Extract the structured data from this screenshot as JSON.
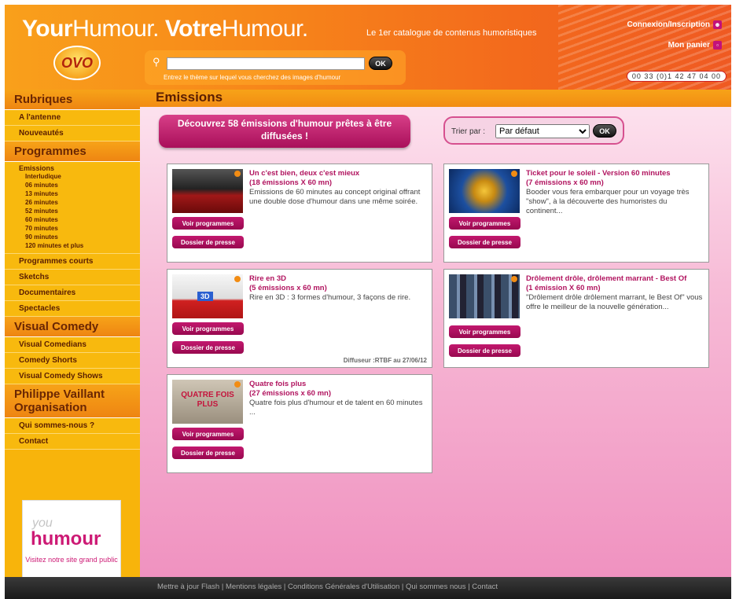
{
  "header": {
    "brand_your": "Your",
    "brand_humour1": "Humour.",
    "brand_votre": "Votre",
    "brand_humour2": "Humour.",
    "tagline": "Le 1er catalogue de contenus humoristiques",
    "logo_text": "OVO",
    "search_placeholder": "",
    "search_button": "OK",
    "search_hint": "Entrez le thème sur lequel vous cherchez des images d'humour",
    "link_login": "Connexion/Inscription",
    "link_cart": "Mon panier",
    "phone": "00 33 (0)1 42 47 04 00"
  },
  "sidebar": {
    "rubriques_title": "Rubriques",
    "rubriques": [
      "A l'antenne",
      "Nouveautés"
    ],
    "programmes_title": "Programmes",
    "emissions_label": "Emissions",
    "emissions_sub": [
      "Interludique",
      "06 minutes",
      "13 minutes",
      "26 minutes",
      "52 minutes",
      "60 minutes",
      "70 minutes",
      "90 minutes",
      "120 minutes et plus"
    ],
    "programmes": [
      "Programmes courts",
      "Sketchs",
      "Documentaires",
      "Spectacles"
    ],
    "visual_title": "Visual Comedy",
    "visual": [
      "Visual Comedians",
      "Comedy Shorts",
      "Visual Comedy Shows"
    ],
    "pvo_title": "Philippe Vaillant Organisation",
    "pvo": [
      "Qui sommes-nous ?",
      "Contact"
    ],
    "promo_you": "you",
    "promo_humour": "humour",
    "promo_visit": "Visitez notre site grand public"
  },
  "main": {
    "title": "Emissions",
    "discover": "Découvrez 58 émissions d'humour prêtes à être diffusées !",
    "sort_label": "Trier par :",
    "sort_value": "Par défaut",
    "sort_button": "OK",
    "btn_programs": "Voir programmes",
    "btn_press": "Dossier de presse",
    "cards": [
      {
        "title": "Un c'est bien, deux c'est mieux",
        "count": "(18 émissions X 60 mn)",
        "desc": "Emissions de 60 minutes au concept original offrant une double dose d'humour dans une même soirée.",
        "diffuseur": ""
      },
      {
        "title": "Ticket pour le soleil - Version 60 minutes",
        "count": "(7 émissions x 60 mn)",
        "desc": "Booder vous fera embarquer pour un voyage très \"show\", à la découverte des humoristes du continent...",
        "diffuseur": ""
      },
      {
        "title": "Rire en 3D",
        "count": "(5 émissions x 60 mn)",
        "desc": "Rire en 3D : 3 formes d'humour, 3 façons de rire.",
        "diffuseur": "Diffuseur :RTBF au 27/06/12"
      },
      {
        "title": "Drôlement drôle, drôlement marrant - Best Of",
        "count": "(1 émission X 60 mn)",
        "desc": "\"Drôlement drôle drôlement marrant, le Best Of\" vous offre le meilleur de la nouvelle génération...",
        "diffuseur": ""
      },
      {
        "title": "Quatre fois plus",
        "count": "(27 émissions x 60 mn)",
        "desc": "Quatre fois plus d'humour et de talent en 60 minutes ...",
        "diffuseur": ""
      }
    ],
    "thumb_texts": {
      "rire3d": "3D",
      "quatre": "QUATRE FOIS PLUS"
    }
  },
  "footer": {
    "links": "Mettre à jour Flash | Mentions légales | Conditions Générales d'Utilisation | Qui sommes nous | Contact"
  }
}
